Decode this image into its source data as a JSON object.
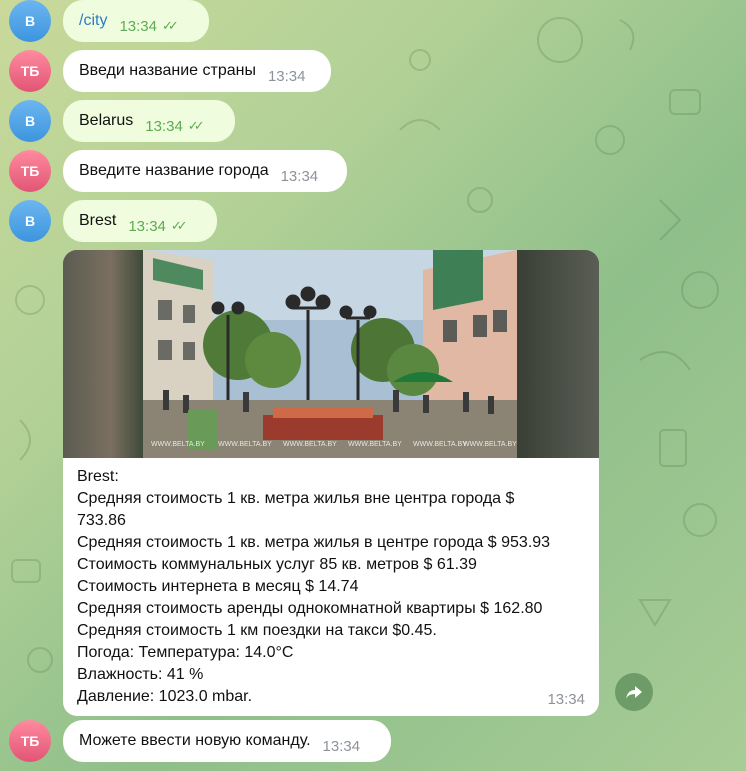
{
  "messages": [
    {
      "avatar": "В",
      "text": "/city",
      "time": "13:34"
    },
    {
      "avatar": "ТБ",
      "text": "Введи название страны",
      "time": "13:34"
    },
    {
      "avatar": "В",
      "text": "Belarus",
      "time": "13:34"
    },
    {
      "avatar": "ТБ",
      "text": "Введите название города",
      "time": "13:34"
    },
    {
      "avatar": "В",
      "text": "Brest",
      "time": "13:34"
    },
    {
      "avatar": "ТБ",
      "text": "Можете ввести новую команду.",
      "time": "13:34"
    }
  ],
  "city_card": {
    "image_watermark": "WWW.BELTA.BY",
    "lines": [
      "Brest:",
      "Средняя стоимость 1 кв. метра жилья вне центра города $",
      "733.86",
      "Средняя стоимость 1 кв. метра жилья в центре города $ 953.93",
      "Стоимость коммунальных услуг 85 кв. метров $ 61.39",
      "Стоимость интернета в месяц $ 14.74",
      "Средняя стоимость аренды однокомнатной квартиры $ 162.80",
      "Средняя стоимость 1 км поездки на такси $0.45.",
      "Погода: Температура: 14.0°C",
      "Влажность: 41 %",
      "Давление: 1023.0 mbar."
    ],
    "time": "13:34"
  },
  "icons": {
    "read": "double-check-icon",
    "share": "forward-arrow-icon"
  },
  "colors": {
    "outgoing": "#effdde",
    "incoming": "#ffffff",
    "check": "#5eaa55",
    "link": "#2f7cc2"
  }
}
